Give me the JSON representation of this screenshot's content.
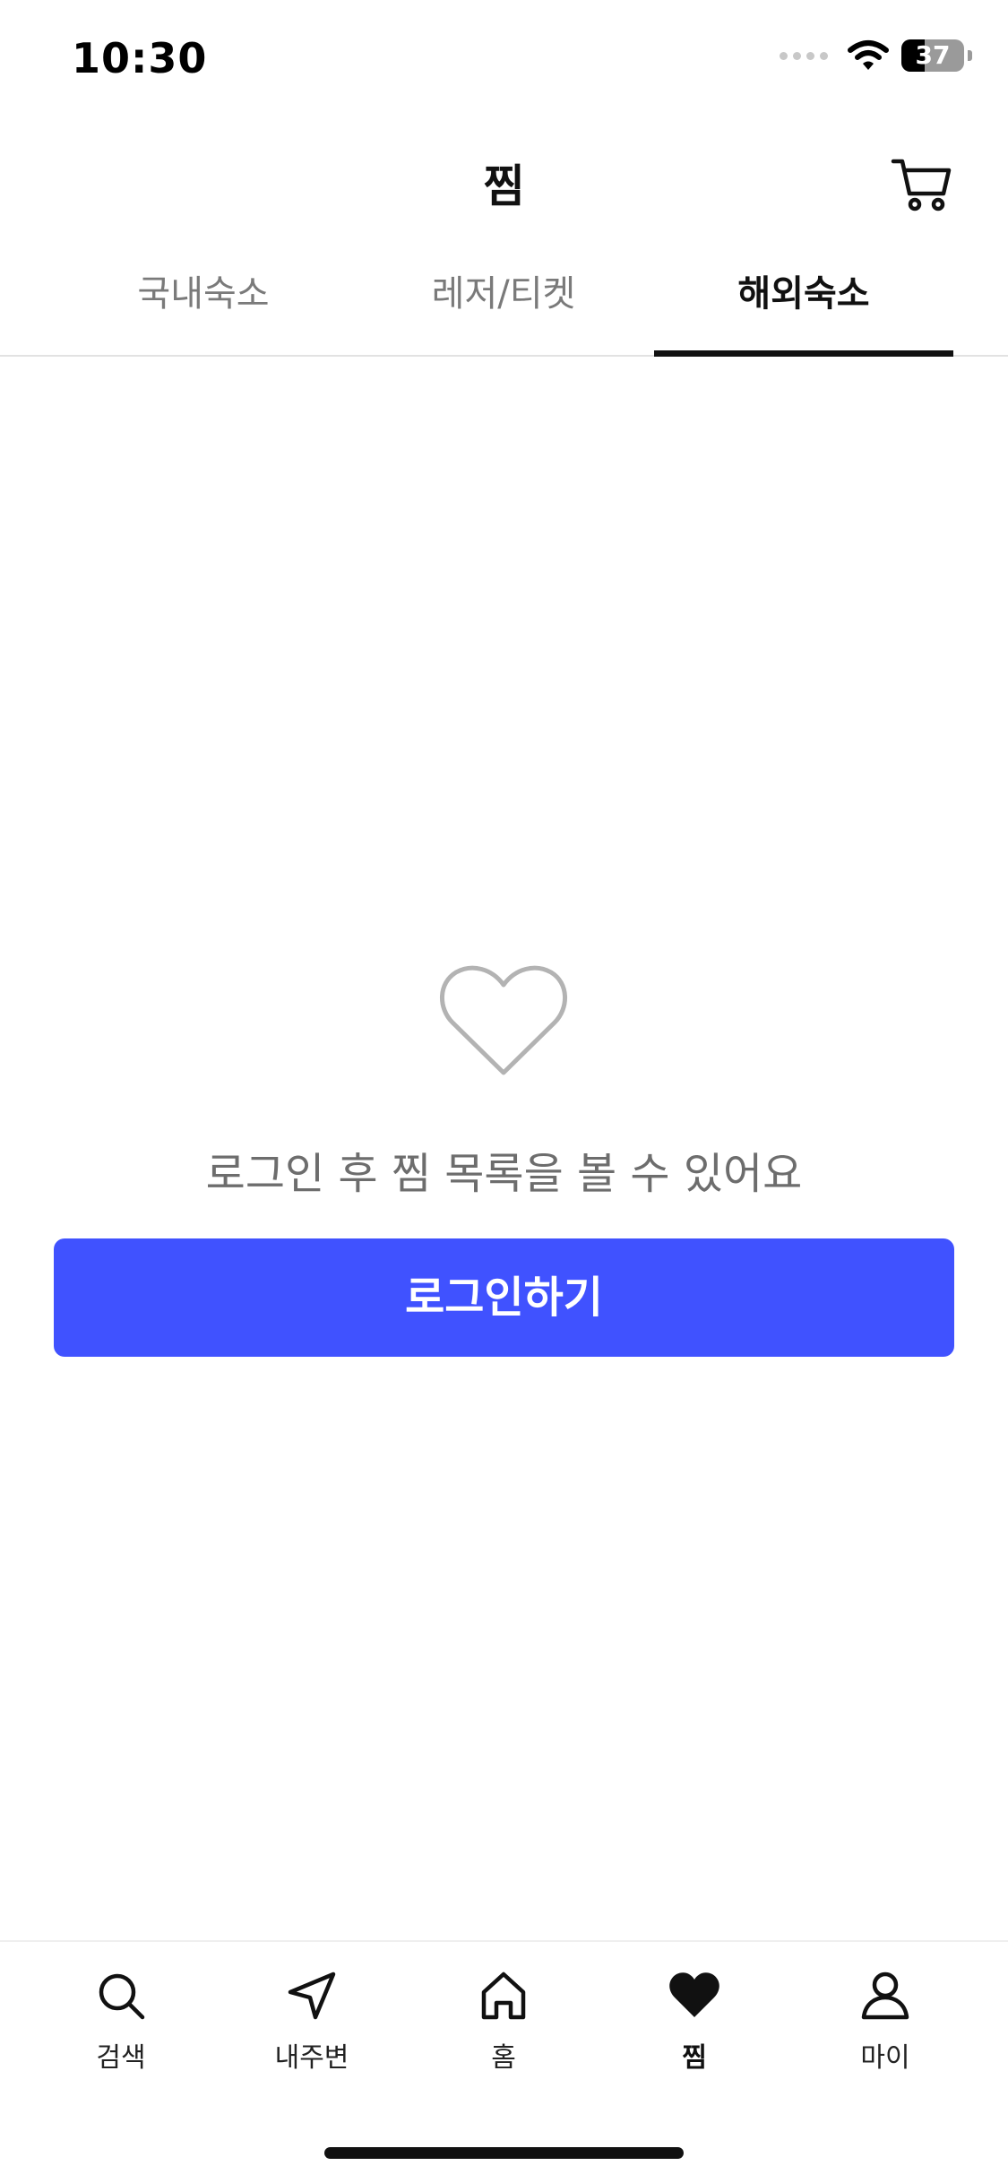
{
  "status_bar": {
    "time": "10:30",
    "battery_level": "37"
  },
  "header": {
    "title": "찜",
    "cart_icon": "cart-icon"
  },
  "tabs": [
    {
      "label": "국내숙소",
      "active": false
    },
    {
      "label": "레저/티켓",
      "active": false
    },
    {
      "label": "해외숙소",
      "active": true
    }
  ],
  "empty_state": {
    "icon": "heart-outline-icon",
    "message": "로그인 후 찜 목록을 볼 수 있어요",
    "login_button": "로그인하기"
  },
  "bottom_nav": [
    {
      "label": "검색",
      "icon": "search-icon",
      "active": false
    },
    {
      "label": "내주변",
      "icon": "navigation-arrow-icon",
      "active": false
    },
    {
      "label": "홈",
      "icon": "home-icon",
      "active": false
    },
    {
      "label": "찜",
      "icon": "heart-filled-icon",
      "active": true
    },
    {
      "label": "마이",
      "icon": "person-icon",
      "active": false
    }
  ],
  "colors": {
    "accent": "#4052ff",
    "text_primary": "#111111",
    "text_secondary": "#7a7a7a"
  }
}
